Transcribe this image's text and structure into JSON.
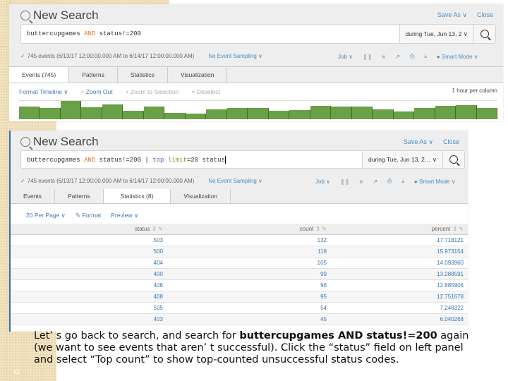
{
  "slide": {
    "number": "42",
    "caption": {
      "part1": "Let’ s go back to search, and search for ",
      "bold": "buttercupgames AND status!=200",
      "part2": " again (we want to see events that aren’ t successful). Click the “status” field on left panel and select “Top count” to show top-counted unsuccessful status codes."
    }
  },
  "screenshot1": {
    "title": "New Search",
    "save_as": "Save As ∨",
    "close": "Close",
    "query": {
      "t1": "buttercupgames ",
      "and": "AND",
      "t2": " status!=200"
    },
    "time_range": "during Tue, Jun 13, 2 ∨",
    "events_status": "745 events (6/13/17 12:00:00.000 AM to 6/14/17 12:00:00.000 AM)",
    "sampling": "No Event Sampling ∨",
    "job": "Job ∨",
    "mode": "Smart Mode ∨",
    "tabs": [
      "Events (745)",
      "Patterns",
      "Statistics",
      "Visualization"
    ],
    "timeline_toolbar": {
      "format": "Format Timeline ∨",
      "zoom_out": "− Zoom Out",
      "zoom_sel": "+ Zoom to Selection",
      "deselect": "× Deselect"
    },
    "scale": "1 hour per column",
    "timeline_values": [
      0.7,
      0.6,
      1.0,
      0.65,
      0.8,
      0.45,
      0.68,
      0.35,
      0.32,
      0.55,
      0.62,
      0.62,
      0.45,
      0.5,
      0.75,
      0.7,
      0.68,
      0.55,
      0.42,
      0.6,
      0.75,
      0.78,
      0.62
    ]
  },
  "screenshot2": {
    "title": "New Search",
    "save_as": "Save As ∨",
    "close": "Close",
    "query": {
      "t1": "buttercupgames ",
      "and": "AND",
      "t2": " status!=200 | ",
      "cmd": "top",
      "t3": " ",
      "arg": "limit",
      "t4": "=20 status"
    },
    "time_range": "during Tue, Jun 13, 2… ∨",
    "events_status": "745 events (6/13/17 12:00:00.000 AM to 6/14/17 12:00:00.000 AM)",
    "sampling": "No Event Sampling ∨",
    "job": "Job ∨",
    "mode": "Smart Mode ∨",
    "tabs": [
      "Events",
      "Patterns",
      "Statistics (8)",
      "Visualization"
    ],
    "stats_toolbar": {
      "per_page": "20 Per Page ∨",
      "format": "✎ Format",
      "preview": "Preview ∨"
    },
    "table": {
      "headers": [
        "status",
        "count",
        "percent"
      ],
      "rows": [
        [
          "503",
          "132",
          "17.718121"
        ],
        [
          "500",
          "119",
          "15.973154"
        ],
        [
          "404",
          "105",
          "14.093960"
        ],
        [
          "400",
          "99",
          "13.288591"
        ],
        [
          "406",
          "96",
          "12.885906"
        ],
        [
          "408",
          "95",
          "12.751678"
        ],
        [
          "505",
          "54",
          "7.248322"
        ],
        [
          "403",
          "45",
          "6.040268"
        ]
      ]
    }
  }
}
